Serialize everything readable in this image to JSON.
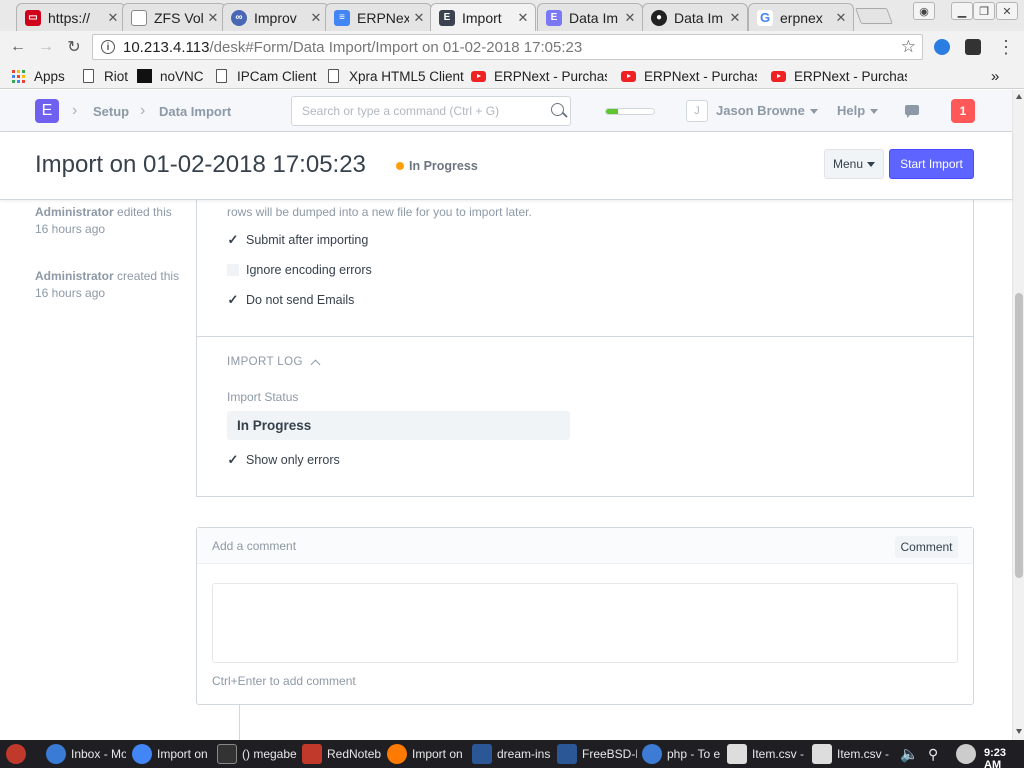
{
  "browser": {
    "tabs": [
      {
        "label": "https://",
        "favicon_color": "#d0021b",
        "favicon_glyph": "▭"
      },
      {
        "label": "ZFS Vol",
        "favicon_color": "#9aa0a6",
        "favicon_glyph": ""
      },
      {
        "label": "Improv",
        "favicon_color": "#4a67b5",
        "favicon_glyph": "∞"
      },
      {
        "label": "ERPNex",
        "favicon_color": "#4285f4",
        "favicon_glyph": "≡"
      },
      {
        "label": "Import",
        "favicon_color": "#3b4351",
        "favicon_glyph": "E"
      },
      {
        "label": "Data Im",
        "favicon_color": "#7b78f5",
        "favicon_glyph": "E"
      },
      {
        "label": "Data Im",
        "favicon_color": "#222222",
        "favicon_glyph": "●"
      },
      {
        "label": "erpnex",
        "favicon_color": "#ffffff",
        "favicon_glyph": "G"
      }
    ],
    "url_host": "10.213.4.113",
    "url_path": "/desk#Form/Data Import/Import on 01-02-2018 17:05:23",
    "bookmarks": [
      {
        "label": "Apps",
        "icon": "apps-grid-icon"
      },
      {
        "label": "Riot",
        "icon": "document-icon"
      },
      {
        "label": "noVNC",
        "icon": "novnc-icon"
      },
      {
        "label": "IPCam Client",
        "icon": "document-icon"
      },
      {
        "label": "Xpra HTML5 Client",
        "icon": "document-icon"
      },
      {
        "label": "ERPNext - Purchas",
        "icon": "youtube-icon"
      },
      {
        "label": "ERPNext - Purchas",
        "icon": "youtube-icon"
      },
      {
        "label": "ERPNext - Purchas",
        "icon": "youtube-icon"
      }
    ],
    "overflow": "»"
  },
  "app": {
    "logo": "E",
    "breadcrumbs": [
      "Setup",
      "Data Import"
    ],
    "search_placeholder": "Search or type a command (Ctrl + G)",
    "progress_fraction": 0.25,
    "user_initial": "J",
    "user_name": "Jason Browne",
    "help_label": "Help",
    "notification_count": "1",
    "accent": "#5e64ff"
  },
  "page": {
    "title": "Import on 01-02-2018 17:05:23",
    "status": "In Progress",
    "status_color": "#ffa00a",
    "menu_label": "Menu",
    "primary_action": "Start Import"
  },
  "timeline": [
    {
      "user": "Administrator",
      "action": "edited this",
      "when": "16 hours ago"
    },
    {
      "user": "Administrator",
      "action": "created this",
      "when": "16 hours ago"
    }
  ],
  "form": {
    "cropped_text": "rows will be dumped into a new file for you to import later.",
    "submit_after_importing": {
      "label": "Submit after importing",
      "checked": true
    },
    "ignore_encoding_errors": {
      "label": "Ignore encoding errors",
      "checked": false
    },
    "do_not_send_emails": {
      "label": "Do not send Emails",
      "checked": true
    },
    "import_log_section": "IMPORT LOG",
    "import_status_label": "Import Status",
    "import_status_value": "In Progress",
    "show_only_errors": {
      "label": "Show only errors",
      "checked": true
    }
  },
  "comments": {
    "placeholder": "Add a comment",
    "button": "Comment",
    "hint": "Ctrl+Enter to add comment"
  },
  "taskbar": {
    "items": [
      {
        "label": "Inbox - Mo",
        "icon_color": "#3a7bd5"
      },
      {
        "label": "Import on",
        "icon_color": "#4285f4"
      },
      {
        "label": "() megabe",
        "icon_color": "#333333"
      },
      {
        "label": "RedNoteb",
        "icon_color": "#c0392b"
      },
      {
        "label": "Import on",
        "icon_color": "#ff7a00"
      },
      {
        "label": "dream-ins",
        "icon_color": "#2b5797"
      },
      {
        "label": "FreeBSD-E",
        "icon_color": "#2b5797"
      },
      {
        "label": "php - To e",
        "icon_color": "#3d7bd4"
      },
      {
        "label": "Item.csv -",
        "icon_color": "#dddddd"
      },
      {
        "label": "Item.csv -",
        "icon_color": "#dddddd"
      }
    ],
    "clock": "9:23 AM"
  }
}
